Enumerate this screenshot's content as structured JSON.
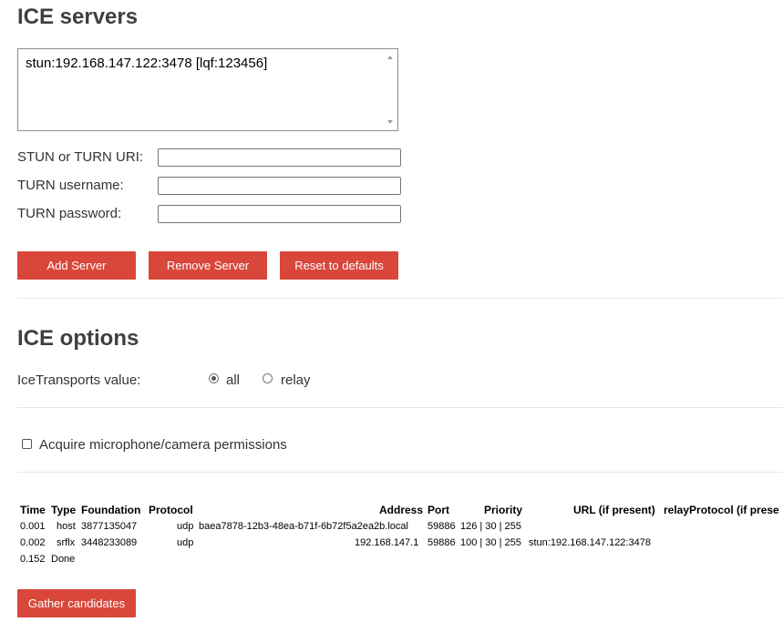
{
  "servers": {
    "heading": "ICE servers",
    "list": [
      "stun:192.168.147.122:3478 [lqf:123456]"
    ],
    "fields": [
      {
        "label": "STUN or TURN URI:",
        "value": "",
        "placeholder": ""
      },
      {
        "label": "TURN username:",
        "value": "",
        "placeholder": ""
      },
      {
        "label": "TURN password:",
        "value": "",
        "placeholder": ""
      }
    ],
    "buttons": {
      "add": "Add Server",
      "remove": "Remove Server",
      "reset": "Reset to defaults"
    }
  },
  "options": {
    "heading": "ICE options",
    "transports_label": "IceTransports value:",
    "transports": [
      {
        "label": "all",
        "checked": true
      },
      {
        "label": "relay",
        "checked": false
      }
    ],
    "permissions_label": "Acquire microphone/camera permissions",
    "permissions_checked": false
  },
  "candidates": {
    "headers": [
      "Time",
      "Type",
      "Foundation",
      "Protocol",
      "Address",
      "Port",
      "Priority",
      "URL (if present)",
      "relayProtocol (if prese"
    ],
    "rows": [
      {
        "time": "0.001",
        "type": "host",
        "foundation": "3877135047",
        "protocol": "udp",
        "address": "baea7878-12b3-48ea-b71f-6b72f5a2ea2b.local",
        "port": "59886",
        "priority": "126 | 30 | 255",
        "url": ""
      },
      {
        "time": "0.002",
        "type": "srflx",
        "foundation": "3448233089",
        "protocol": "udp",
        "address": "192.168.147.1",
        "port": "59886",
        "priority": "100 | 30 | 255",
        "url": "stun:192.168.147.122:3478"
      }
    ],
    "done": {
      "time": "0.152",
      "label": "Done"
    },
    "gather_button": "Gather candidates"
  },
  "colors": {
    "button": "#d9463a",
    "heading": "#404040"
  }
}
